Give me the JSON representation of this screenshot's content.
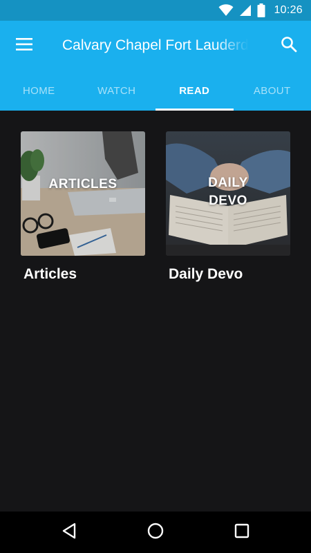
{
  "status_bar": {
    "time": "10:26",
    "icons": [
      "wifi-icon",
      "signal-icon",
      "battery-icon"
    ]
  },
  "app_bar": {
    "title": "Calvary Chapel Fort Lauderdale",
    "menu_icon": "hamburger-menu-icon",
    "search_icon": "search-icon"
  },
  "tabs": [
    {
      "label": "HOME",
      "active": false
    },
    {
      "label": "WATCH",
      "active": false
    },
    {
      "label": "READ",
      "active": true
    },
    {
      "label": "ABOUT",
      "active": false
    }
  ],
  "cards": [
    {
      "overlay": "ARTICLES",
      "caption": "Articles"
    },
    {
      "overlay_line1": "DAILY",
      "overlay_line2": "DEVO",
      "caption": "Daily Devo"
    }
  ],
  "nav_bar": {
    "icons": [
      "back-icon",
      "home-icon",
      "recents-icon"
    ]
  },
  "colors": {
    "status_bar": "#1592c2",
    "app_bar": "#1ab0ee",
    "background": "#151517"
  }
}
